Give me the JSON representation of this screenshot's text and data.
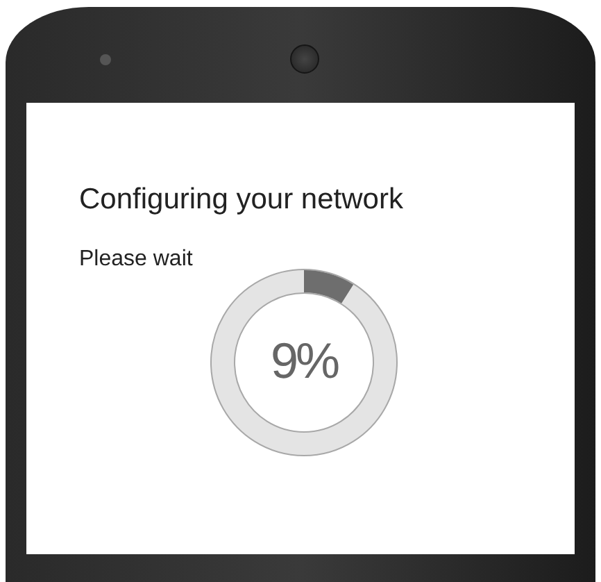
{
  "screen": {
    "title": "Configuring your network",
    "subtitle": "Please wait"
  },
  "progress": {
    "level": 0.09,
    "label": "9%"
  }
}
